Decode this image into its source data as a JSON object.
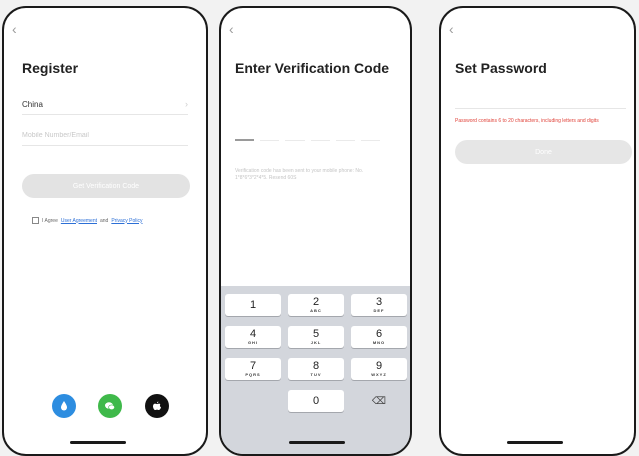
{
  "register": {
    "back": "‹",
    "title": "Register",
    "country": "China",
    "country_chevron": "›",
    "phone_placeholder": "Mobile Number/Email",
    "get_code_button": "Get Verification Code",
    "agree_prefix": "I Agree",
    "agreement_link": "User Agreement",
    "agree_and": "and",
    "privacy_link": "Privacy Policy",
    "social": [
      {
        "icon": "drop-icon",
        "color": "#2d8de0"
      },
      {
        "icon": "wechat-icon",
        "color": "#3fb94a"
      },
      {
        "icon": "apple-icon",
        "color": "#111111"
      }
    ]
  },
  "verify": {
    "back": "‹",
    "title": "Enter Verification Code",
    "helper": "Verification code has been sent to your mobile phone: No. 1*8*6*3*2*4*5. Resend 60S",
    "keys": [
      {
        "num": "1",
        "letters": ""
      },
      {
        "num": "2",
        "letters": "ABC"
      },
      {
        "num": "3",
        "letters": "DEF"
      },
      {
        "num": "4",
        "letters": "GHI"
      },
      {
        "num": "5",
        "letters": "JKL"
      },
      {
        "num": "6",
        "letters": "MNO"
      },
      {
        "num": "7",
        "letters": "PQRS"
      },
      {
        "num": "8",
        "letters": "TUV"
      },
      {
        "num": "9",
        "letters": "WXYZ"
      },
      {
        "num": "0",
        "letters": ""
      }
    ],
    "delete_key": "⌫"
  },
  "password": {
    "back": "‹",
    "title": "Set Password",
    "error": "Password contains 6 to 20 characters, including letters and digits",
    "done_button": "Done"
  }
}
